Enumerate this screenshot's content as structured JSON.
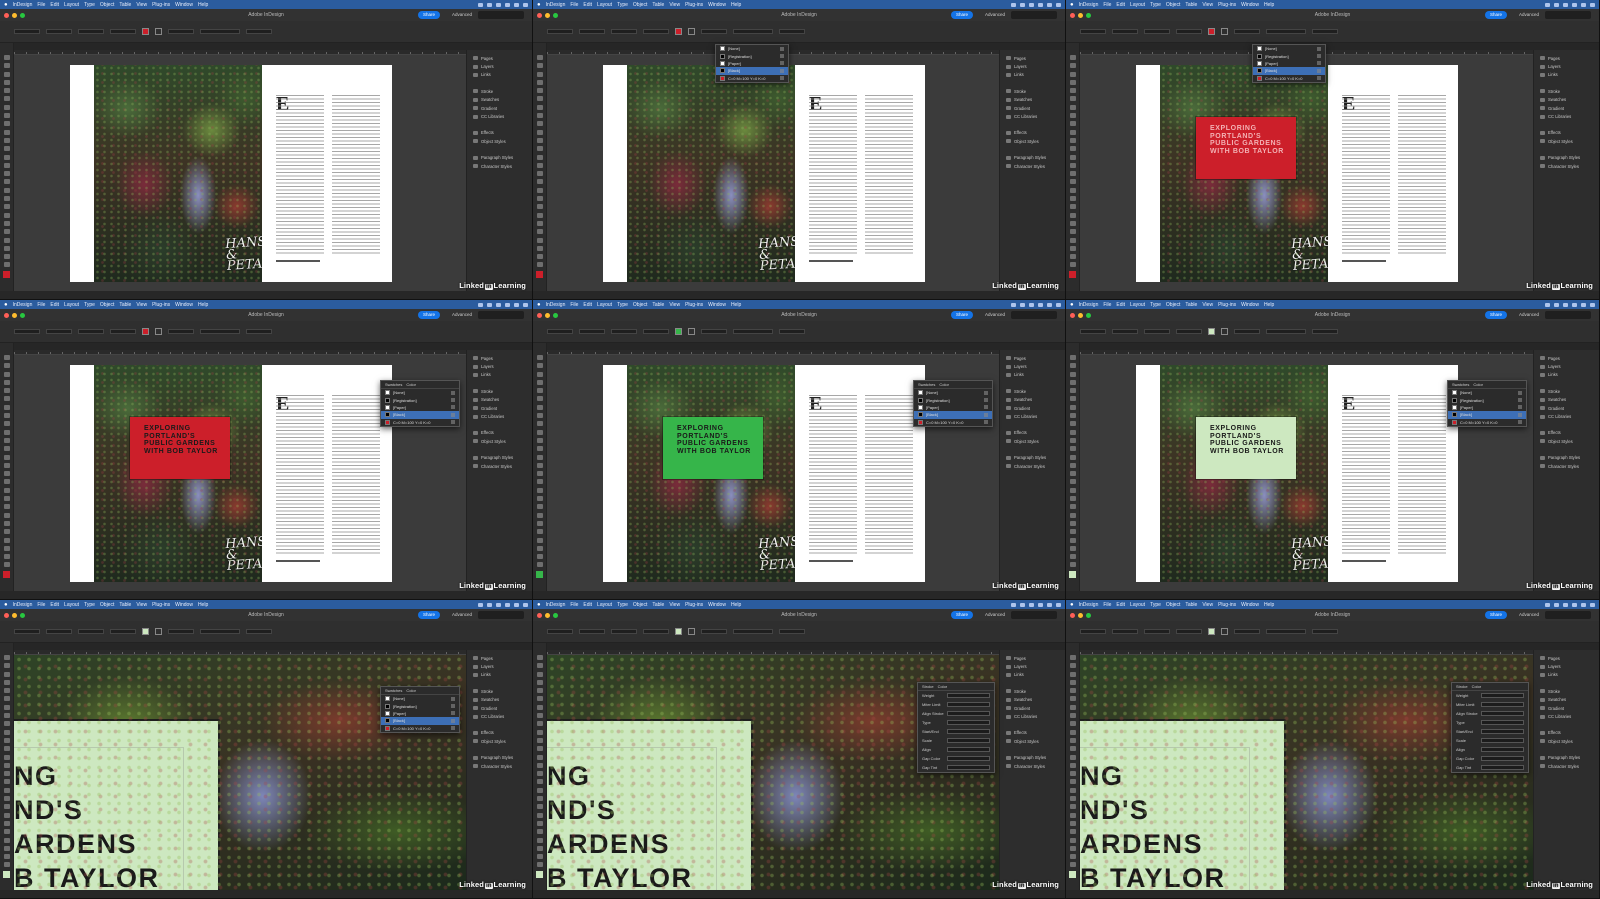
{
  "menubar": {
    "app_name": "InDesign",
    "items": [
      "File",
      "Edit",
      "Layout",
      "Type",
      "Object",
      "Table",
      "View",
      "Plug-ins",
      "Window",
      "Help"
    ]
  },
  "app": {
    "title": "Adobe InDesign",
    "share_label": "Share",
    "workspace_label": "Advanced"
  },
  "panels": {
    "group1": [
      "Pages",
      "Layers",
      "Links"
    ],
    "group2": [
      "Stroke",
      "Swatches",
      "Gradient",
      "CC Libraries"
    ],
    "group3": [
      "Effects",
      "Object Styles"
    ],
    "group4": [
      "Paragraph Styles",
      "Character Styles"
    ]
  },
  "watermark": {
    "before": "Linked",
    "in": "in",
    "after": "Learning"
  },
  "article": {
    "title_lines": [
      "EXPLORING",
      "PORTLAND'S",
      "PUBLIC GARDENS",
      "WITH BOB TAYLOR"
    ],
    "dropcap": "E",
    "logo_line1": "HANSEL",
    "logo_line2": "& PETAL"
  },
  "zoom_lines": [
    "NG",
    "ND'S",
    "ARDENS",
    "B TAYLOR"
  ],
  "swatches": {
    "tabs": [
      "Swatches",
      "Color"
    ],
    "rows": [
      "[None]",
      "[Registration]",
      "[Paper]",
      "[Black]",
      "C=0 M=100 Y=0 K=0"
    ]
  },
  "stroke_panel": {
    "tabs": [
      "Stroke",
      "Color"
    ],
    "rows": [
      "Weight",
      "Miter Limit",
      "Align Stroke",
      "Type",
      "Start/End",
      "Scale",
      "Align",
      "Gap Color",
      "Gap Tint"
    ]
  },
  "colors": {
    "menubar": "#2b5c9e",
    "title_red": "#cc1f2a",
    "title_green": "#36b54a",
    "title_mint": "#cde8c0",
    "share": "#1473e6"
  },
  "frames": [
    {
      "box_color": "#cc1f2a",
      "box_text": "#1a1a1a",
      "title_box": false,
      "dialog": "none",
      "view": "spread"
    },
    {
      "box_color": "#cc1f2a",
      "box_text": "#1a1a1a",
      "title_box": false,
      "dialog": "swatch-dropdown",
      "view": "spread"
    },
    {
      "box_color": "#cc1f2a",
      "box_text": "#f3b1b4",
      "title_box": true,
      "dialog": "swatch-dropdown",
      "view": "spread"
    },
    {
      "box_color": "#cc1f2a",
      "box_text": "#1a1a1a",
      "title_box": true,
      "dialog": "swatches",
      "view": "spread"
    },
    {
      "box_color": "#36b54a",
      "box_text": "#1a1a1a",
      "title_box": true,
      "dialog": "swatches",
      "view": "spread"
    },
    {
      "box_color": "#cde8c0",
      "box_text": "#1a1a1a",
      "title_box": true,
      "dialog": "swatches",
      "view": "spread"
    },
    {
      "box_color": "#cde8c0",
      "box_text": "#1a1a1a",
      "title_box": false,
      "dialog": "swatches",
      "view": "zoom"
    },
    {
      "box_color": "#cde8c0",
      "box_text": "#1a1a1a",
      "title_box": false,
      "dialog": "stroke",
      "view": "zoom"
    },
    {
      "box_color": "#cde8c0",
      "box_text": "#1a1a1a",
      "title_box": false,
      "dialog": "stroke",
      "view": "zoom"
    }
  ]
}
